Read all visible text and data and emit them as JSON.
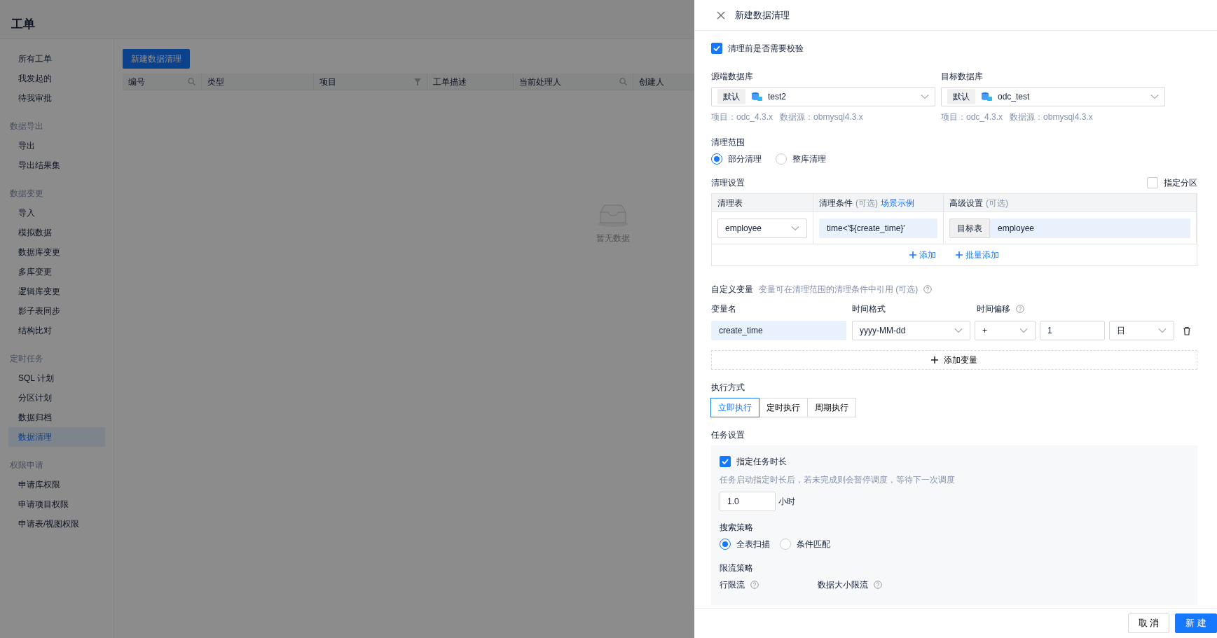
{
  "page": {
    "title": "工单"
  },
  "sidebar": {
    "groups": [
      {
        "items": [
          {
            "label": "所有工单",
            "selected": false
          },
          {
            "label": "我发起的",
            "selected": false
          },
          {
            "label": "待我审批",
            "selected": false
          }
        ]
      },
      {
        "heading": "数据导出",
        "items": [
          {
            "label": "导出",
            "selected": false
          },
          {
            "label": "导出结果集",
            "selected": false
          }
        ]
      },
      {
        "heading": "数据变更",
        "items": [
          {
            "label": "导入",
            "selected": false
          },
          {
            "label": "模拟数据",
            "selected": false
          },
          {
            "label": "数据库变更",
            "selected": false
          },
          {
            "label": "多库变更",
            "selected": false
          },
          {
            "label": "逻辑库变更",
            "selected": false
          },
          {
            "label": "影子表同步",
            "selected": false
          },
          {
            "label": "结构比对",
            "selected": false
          }
        ]
      },
      {
        "heading": "定时任务",
        "items": [
          {
            "label": "SQL 计划",
            "selected": false
          },
          {
            "label": "分区计划",
            "selected": false
          },
          {
            "label": "数据归档",
            "selected": false
          },
          {
            "label": "数据清理",
            "selected": true
          }
        ]
      },
      {
        "heading": "权限申请",
        "items": [
          {
            "label": "申请库权限",
            "selected": false
          },
          {
            "label": "申请项目权限",
            "selected": false
          },
          {
            "label": "申请表/视图权限",
            "selected": false
          }
        ]
      }
    ]
  },
  "toolbar": {
    "new_button": "新建数据清理"
  },
  "table": {
    "columns": [
      {
        "label": "编号",
        "kind": "search"
      },
      {
        "label": "类型"
      },
      {
        "label": "项目",
        "kind": "funnel"
      },
      {
        "label": "工单描述"
      },
      {
        "label": "当前处理人",
        "kind": "search"
      },
      {
        "label": "创建人"
      }
    ],
    "empty_text": "暂无数据"
  },
  "drawer": {
    "title": "新建数据清理",
    "verify": {
      "label": "清理前是否需要校验",
      "checked": true
    },
    "databases": [
      {
        "label": "源端数据库",
        "tag": "默认",
        "value": "test2",
        "project": "项目：odc_4.3.x",
        "datasource": "数据源：obmysql4.3.x"
      },
      {
        "label": "目标数据库",
        "tag": "默认",
        "value": "odc_test",
        "project": "项目：odc_4.3.x",
        "datasource": "数据源：obmysql4.3.x"
      }
    ],
    "scope": {
      "label": "清理范围",
      "options": [
        {
          "label": "部分清理",
          "selected": true
        },
        {
          "label": "整库清理",
          "selected": false
        }
      ]
    },
    "settings": {
      "label": "清理设置",
      "partition": {
        "label": "指定分区",
        "checked": false
      },
      "columns": [
        {
          "label": "清理表"
        },
        {
          "label": "清理条件",
          "hint": "(可选)",
          "link": "场景示例"
        },
        {
          "label": "高级设置",
          "hint": "(可选)"
        }
      ],
      "rows": [
        {
          "table": "employee",
          "condition": "time<'${create_time}'",
          "target_label": "目标表",
          "target": "employee"
        }
      ],
      "add": "添加",
      "batch_add": "批量添加"
    },
    "variables": {
      "label": "自定义变量",
      "hint": "变量可在清理范围的清理条件中引用 (可选)",
      "columns": [
        "变量名",
        "时间格式",
        "时间偏移"
      ],
      "rows": [
        {
          "name": "create_time",
          "format": "yyyy-MM-dd",
          "sign": "+",
          "amount": "1",
          "unit": "日"
        }
      ],
      "add": "添加变量"
    },
    "execution": {
      "label": "执行方式",
      "options": [
        {
          "label": "立即执行",
          "selected": true
        },
        {
          "label": "定时执行",
          "selected": false
        },
        {
          "label": "周期执行",
          "selected": false
        }
      ]
    },
    "task": {
      "label": "任务设置",
      "duration": {
        "label": "指定任务时长",
        "checked": true,
        "help": "任务启动指定时长后，若未完成则会暂停调度，等待下一次调度",
        "value": "1.0",
        "unit": "小时"
      },
      "search": {
        "label": "搜索策略",
        "options": [
          {
            "label": "全表扫描",
            "selected": true
          },
          {
            "label": "条件匹配",
            "selected": false
          }
        ]
      },
      "throttle": {
        "label": "限流策略",
        "items": [
          "行限流",
          "数据大小限流"
        ]
      }
    },
    "footer": {
      "cancel": "取 消",
      "submit": "新 建"
    }
  }
}
